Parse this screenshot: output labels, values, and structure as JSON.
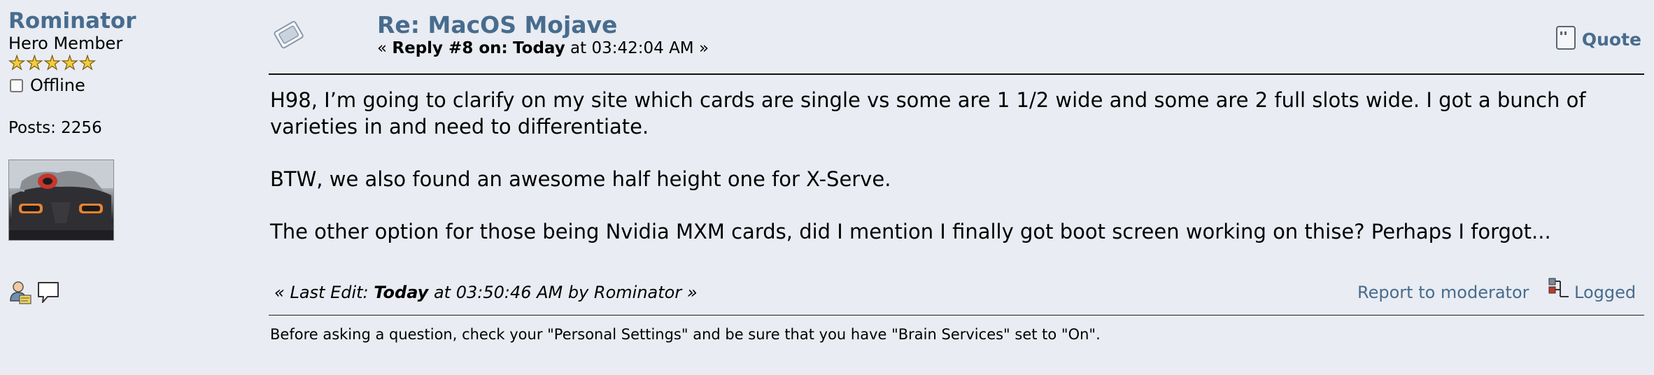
{
  "poster": {
    "name": "Rominator",
    "rank": "Hero Member",
    "stars": [
      "★",
      "★",
      "★",
      "★",
      "★"
    ],
    "online_status": "Offline",
    "posts": "Posts: 2256",
    "icons": [
      "profile-icon",
      "personal-message-icon"
    ]
  },
  "post": {
    "subject": "Re: MacOS Mojave",
    "reply_prefix": "« ",
    "reply_number": "Reply #8 on:",
    "reply_day": "Today",
    "reply_time": " at 03:42:04 AM »",
    "quote_label": "Quote",
    "body": [
      "H98, I’m going to clarify on my site which cards are single vs some are 1 1/2 wide and some are 2 full slots wide. I got a bunch of varieties in and need to differentiate.",
      "BTW, we also found an awesome half height one for X-Serve.",
      "The other option for those being Nvidia MXM cards, did I mention I finally got boot screen working on thise? Perhaps I forgot..."
    ],
    "edit_prefix": "« Last Edit: ",
    "edit_day": "Today",
    "edit_suffix": " at 03:50:46 AM by Rominator »",
    "report_label": "Report to moderator",
    "logged_label": "Logged",
    "signature": "Before asking a question, check your \"Personal Settings\" and be sure that you have \"Brain Services\" set to \"On\"."
  },
  "colors": {
    "link": "#476c8e",
    "background": "#e9ecf2",
    "star": "#f4cc3c"
  }
}
